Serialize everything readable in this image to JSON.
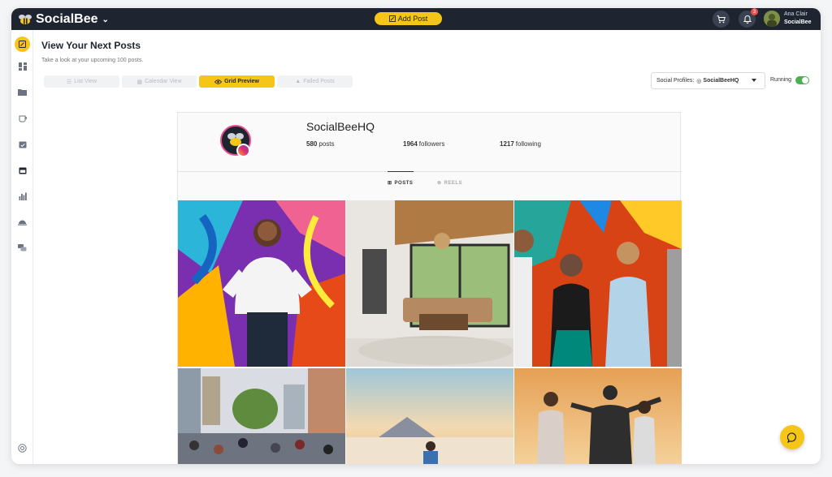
{
  "app": {
    "brand": "SocialBee",
    "add_post_label": "Add Post"
  },
  "topbar": {
    "notification_count": "3",
    "user_name": "Ana Clair",
    "user_org": "SocialBee"
  },
  "page": {
    "title": "View Your Next Posts",
    "subtitle": "Take a look at your upcoming 100 posts."
  },
  "views": {
    "list": "List View",
    "calendar": "Calendar View",
    "grid": "Grid Preview",
    "failed": "Failed Posts"
  },
  "profile_select": {
    "label": "Social Profiles:",
    "value": "SocialBeeHQ"
  },
  "running_label": "Running",
  "instagram": {
    "handle": "SocialBeeHQ",
    "posts_count": "580",
    "posts_label": "posts",
    "followers_count": "1964",
    "followers_label": "followers",
    "following_count": "1217",
    "following_label": "following",
    "tab_posts": "POSTS",
    "tab_reels": "REELS"
  },
  "colors": {
    "accent": "#f5c518",
    "topbar": "#1e2430",
    "running": "#4caf50"
  }
}
